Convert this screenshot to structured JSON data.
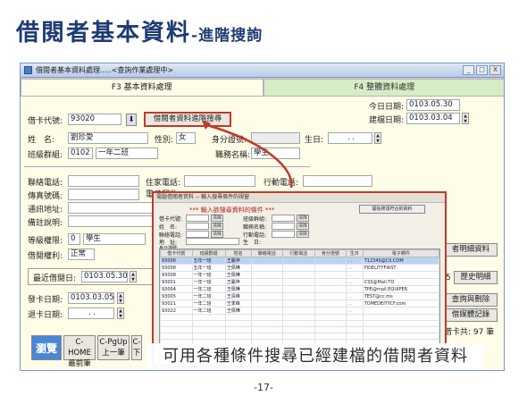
{
  "slide": {
    "title": "借閱者基本資料",
    "subtitle": "-進階搜詢",
    "page_number": "-17-",
    "caption": "可用各種條件搜尋已經建檔的借閱者資料"
  },
  "window": {
    "title": "借閱者基本資料處理.....<查詢作業處理中>",
    "controls": [
      "_",
      "□",
      "X"
    ]
  },
  "tabs": [
    {
      "label": "F3 基本資料處理",
      "active": true
    },
    {
      "label": "F4 整體資料處理",
      "active": false
    }
  ],
  "form": {
    "today_label": "今日日期:",
    "today_value": "0103.05.30",
    "created_label": "建檔日期:",
    "created_value": "0103.03.04",
    "card_label": "借卡代號:",
    "card_value": "93020",
    "advanced_search_button": "借閱者資料進階搜尋",
    "name_label": "姓　名:",
    "name_value": "劉珍愛",
    "gender_label": "性別:",
    "gender_value": "女",
    "id_label": "身分證號:",
    "birthday_label": "生日:",
    "birthday_value": ". .",
    "class_label": "班級群組:",
    "class_code": "0102",
    "class_name": "一年二班",
    "job_label": "職務名稱:",
    "job_value": "學生",
    "contact_phone_label": "聯絡電話:",
    "home_phone_label": "住家電話:",
    "mobile_label": "行動電話:",
    "fax_label": "傳真號碼:",
    "email_label": "電子郵件:",
    "address_label": "通訊地址:",
    "notes_label": "備註說明:",
    "level_label": "等級權限:",
    "level_code": "0",
    "level_name": "學生",
    "borrow_right_label": "借閱權利:",
    "borrow_right_value": "正常",
    "recent_borrow_label": "最近借閱日:",
    "recent_borrow_value": "0103.05.30",
    "issue_date_label": "發卡日期:",
    "issue_date_value": "0103.03.05",
    "return_date_label": "退卡日期:",
    "return_date_value": ". ."
  },
  "right_buttons": {
    "detail": "者明細資料",
    "history_prefix": "5",
    "history": "歷史明細",
    "query_delete": "查詢與刪除",
    "media_record": "借媒體記錄",
    "borrow_count": "借卡共: 97 筆"
  },
  "bottom_buttons": [
    {
      "label": "瀏覽",
      "style": "blue"
    },
    {
      "label": "C-HOME\n最前筆",
      "style": "normal"
    },
    {
      "label": "C-PgUp\n上一筆",
      "style": "normal"
    },
    {
      "label": "C-\n下",
      "style": "normal"
    }
  ],
  "popup": {
    "title": "電腦借閱者資料 -- 輸入搜尋條件的視窗",
    "heading": "*** 輸入欲搜尋資料的條件 ***",
    "start_search_button": "開始搜尋符合的資料",
    "fields_left": [
      "借卡代號:",
      "姓　名:",
      "聯絡電話:",
      "地　址:",
      "身分證號:"
    ],
    "fields_right": [
      "班級群組:",
      "職務名稱:",
      "行動電話:"
    ],
    "birthday_label": "生　日:",
    "clear_label": "清除",
    "columns": [
      "借卡代號",
      "班級群組",
      "姓名",
      "聯絡電話",
      "行動電話",
      "身分證號",
      "生日",
      "電子郵件"
    ],
    "rows": [
      {
        "card": "93006",
        "klass": "五年一班",
        "name": "王麗萍",
        "phone": "",
        "mobile": "",
        "id": "",
        "bday": ". .",
        "email": "T1234S@CS.COM"
      },
      {
        "card": "93008",
        "klass": "五年一班",
        "name": "王佩樺",
        "phone": "",
        "mobile": "",
        "id": "",
        "bday": ". .",
        "email": "FIDELITYFIAST"
      },
      {
        "card": "93008",
        "klass": "一年一班",
        "name": "王佩樺",
        "phone": "",
        "mobile": "",
        "id": "",
        "bday": ". .",
        "email": ""
      },
      {
        "card": "93001",
        "klass": "一年一班",
        "name": "王麗萍",
        "phone": "",
        "mobile": "",
        "id": "",
        "bday": ". .",
        "email": "CSS@Mail.TO"
      },
      {
        "card": "93004",
        "klass": "一年二班",
        "name": "王佩樺",
        "phone": "",
        "mobile": "",
        "id": "",
        "bday": ". .",
        "email": "TPE@mail.EQUIPER"
      },
      {
        "card": "93005",
        "klass": "一年二班",
        "name": "王清峰",
        "phone": "",
        "mobile": "",
        "id": "",
        "bday": ". .",
        "email": "TEST@cc.ms"
      },
      {
        "card": "93021",
        "klass": "一年二班",
        "name": "王季峰",
        "phone": "",
        "mobile": "",
        "id": "",
        "bday": ". .",
        "email": "TOMEDEITYCF.com"
      },
      {
        "card": "93022",
        "klass": "一年二班",
        "name": "王佩樺",
        "phone": "",
        "mobile": "",
        "id": "",
        "bday": ". .",
        "email": ""
      }
    ]
  }
}
